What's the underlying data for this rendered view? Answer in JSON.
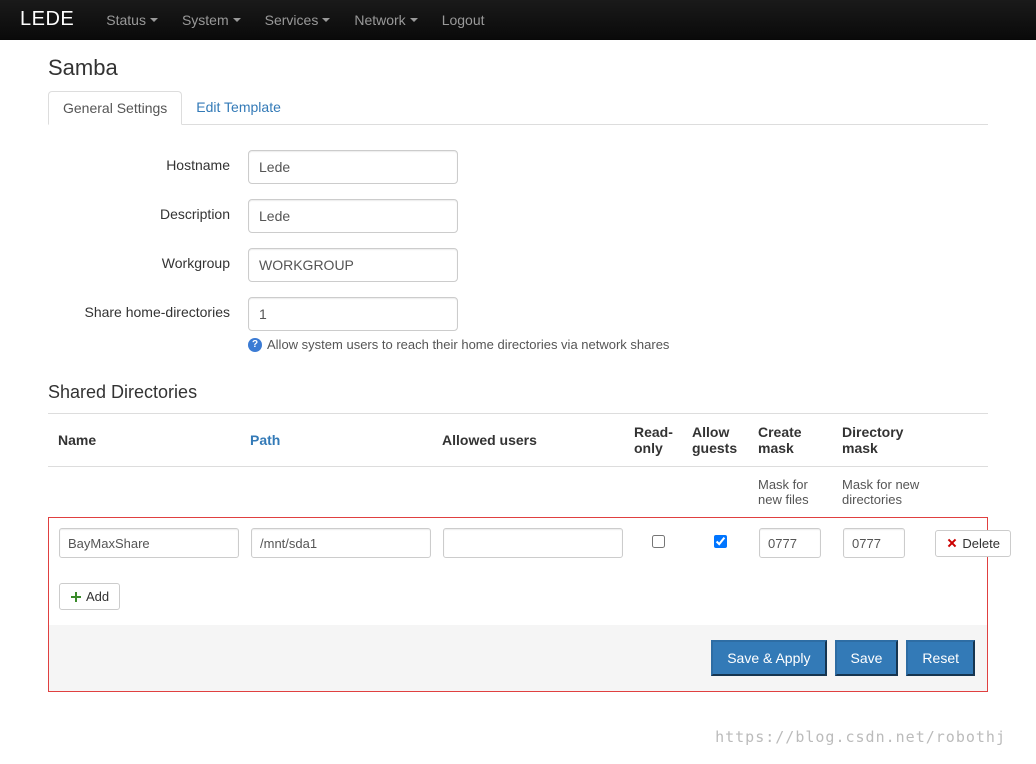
{
  "nav": {
    "brand": "LEDE",
    "items": [
      {
        "label": "Status",
        "dropdown": true
      },
      {
        "label": "System",
        "dropdown": true
      },
      {
        "label": "Services",
        "dropdown": true
      },
      {
        "label": "Network",
        "dropdown": true
      },
      {
        "label": "Logout",
        "dropdown": false
      }
    ]
  },
  "page": {
    "title": "Samba",
    "tabs": {
      "general": "General Settings",
      "edit_template": "Edit Template",
      "active_index": 0
    }
  },
  "form": {
    "hostname": {
      "label": "Hostname",
      "value": "Lede"
    },
    "description": {
      "label": "Description",
      "value": "Lede"
    },
    "workgroup": {
      "label": "Workgroup",
      "value": "WORKGROUP"
    },
    "share_home": {
      "label": "Share home-directories",
      "value": "1",
      "help": "Allow system users to reach their home directories via network shares"
    }
  },
  "shared": {
    "title": "Shared Directories",
    "headers": {
      "name": "Name",
      "path": "Path",
      "users": "Allowed users",
      "ro": "Read-only",
      "guests": "Allow guests",
      "cmask": "Create mask",
      "dmask": "Directory mask"
    },
    "hints": {
      "cmask": "Mask for new files",
      "dmask": "Mask for new directories"
    },
    "rows": [
      {
        "name": "BayMaxShare",
        "path": "/mnt/sda1",
        "users": "",
        "ro": false,
        "guests": true,
        "cmask": "0777",
        "dmask": "0777"
      }
    ],
    "buttons": {
      "add": "Add",
      "delete": "Delete"
    }
  },
  "actions": {
    "save_apply": "Save & Apply",
    "save": "Save",
    "reset": "Reset"
  },
  "watermark": "https://blog.csdn.net/robothj"
}
